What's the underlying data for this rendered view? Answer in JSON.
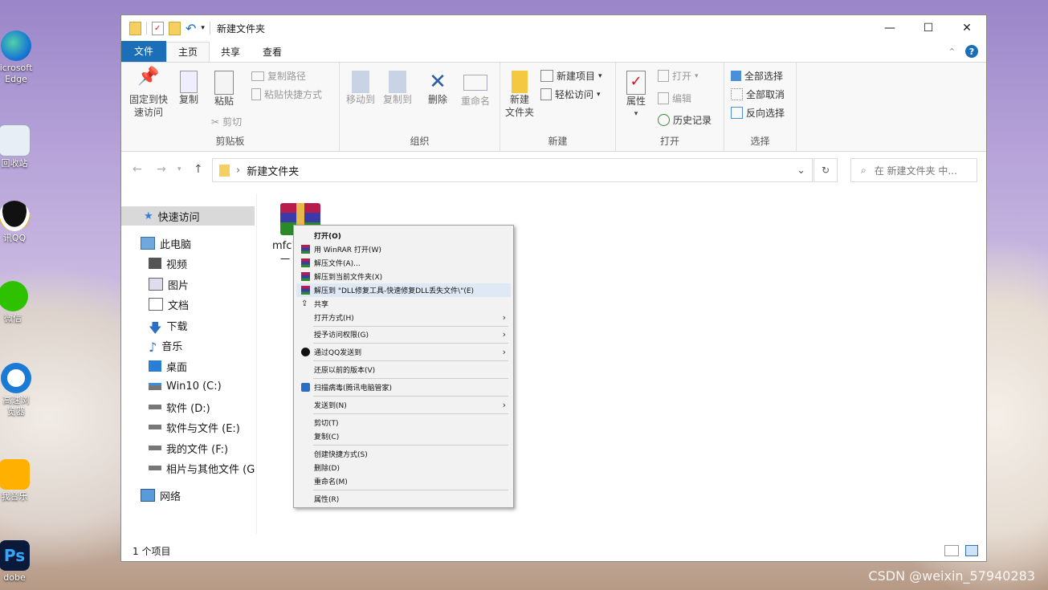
{
  "desktop": {
    "icons": [
      {
        "label": "icrosoft\nEdge",
        "name": "edge"
      },
      {
        "label": "回收站",
        "name": "recycle-bin"
      },
      {
        "label": "讯QQ",
        "name": "qq"
      },
      {
        "label": "微信",
        "name": "wechat"
      },
      {
        "label": "高速浏\n览器",
        "name": "sogou-browser"
      },
      {
        "label": "我音乐",
        "name": "kuwo-music"
      },
      {
        "label": "dobe",
        "name": "photoshop"
      }
    ]
  },
  "window": {
    "title": "新建文件夹",
    "tabs": [
      "文件",
      "主页",
      "共享",
      "查看"
    ],
    "active_tab": "主页",
    "ribbon": {
      "clipboard": {
        "label": "剪贴板",
        "pin": "固定到快\n速访问",
        "copy": "复制",
        "paste": "粘贴",
        "copy_path": "复制路径",
        "paste_shortcut": "粘贴快捷方式",
        "cut": "剪切"
      },
      "organize": {
        "label": "组织",
        "move_to": "移动到",
        "copy_to": "复制到",
        "delete": "删除",
        "rename": "重命名"
      },
      "new": {
        "label": "新建",
        "new_folder": "新建\n文件夹",
        "new_item": "新建项目",
        "easy_access": "轻松访问"
      },
      "open": {
        "label": "打开",
        "properties": "属性",
        "open": "打开",
        "edit": "编辑",
        "history": "历史记录"
      },
      "select": {
        "label": "选择",
        "select_all": "全部选择",
        "select_none": "全部取消",
        "invert": "反向选择"
      }
    },
    "address": {
      "path": "新建文件夹",
      "search_placeholder": "在 新建文件夹 中..."
    },
    "nav": {
      "quick_access": "快速访问",
      "this_pc": "此电脑",
      "items": [
        "视频",
        "图片",
        "文档",
        "下载",
        "音乐",
        "桌面",
        "Win10 (C:)",
        "软件 (D:)",
        "软件与文件 (E:)",
        "我的文件 (F:)",
        "相片与其他文件 (G:"
      ],
      "network": "网络"
    },
    "file": {
      "name": "mfc1",
      "sub": "一"
    },
    "status": "1 个项目"
  },
  "context_menu": {
    "items": [
      {
        "label": "打开(O)",
        "bold": true
      },
      {
        "label": "用 WinRAR 打开(W)",
        "icon": "winrar-icon"
      },
      {
        "label": "解压文件(A)...",
        "icon": "winrar-icon"
      },
      {
        "label": "解压到当前文件夹(X)",
        "icon": "winrar-icon"
      },
      {
        "label": "解压到 \"DLL修复工具-快速修复DLL丢失文件\\\"(E)",
        "icon": "winrar-icon",
        "highlight": true
      },
      {
        "label": "共享",
        "icon": "share-icon"
      },
      {
        "label": "打开方式(H)",
        "submenu": true
      },
      {
        "label": "授予访问权限(G)",
        "submenu": true
      },
      {
        "label": "通过QQ发送到",
        "icon": "qq-icon",
        "submenu": true
      },
      {
        "label": "还原以前的版本(V)"
      },
      {
        "label": "扫描病毒(腾讯电脑管家)",
        "icon": "shield-icon"
      },
      {
        "label": "发送到(N)",
        "submenu": true
      },
      {
        "label": "剪切(T)"
      },
      {
        "label": "复制(C)"
      },
      {
        "label": "创建快捷方式(S)"
      },
      {
        "label": "删除(D)"
      },
      {
        "label": "重命名(M)"
      },
      {
        "label": "属性(R)"
      }
    ]
  },
  "watermark": "CSDN @weixin_57940283"
}
